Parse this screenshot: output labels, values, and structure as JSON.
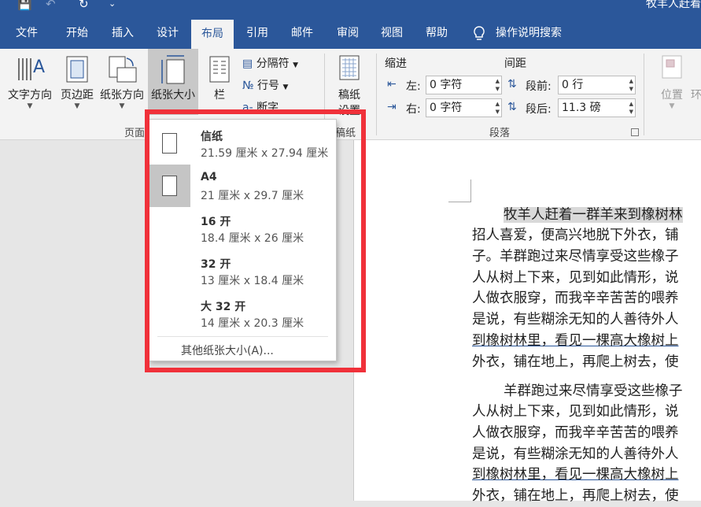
{
  "title_bar": {
    "doc_title": "牧羊人赶着"
  },
  "tabs": [
    {
      "label": "文件"
    },
    {
      "label": "开始"
    },
    {
      "label": "插入"
    },
    {
      "label": "设计"
    },
    {
      "label": "布局"
    },
    {
      "label": "引用"
    },
    {
      "label": "邮件"
    },
    {
      "label": "审阅"
    },
    {
      "label": "视图"
    },
    {
      "label": "帮助"
    },
    {
      "label": "操作说明搜索"
    }
  ],
  "active_tab": "布局",
  "ribbon": {
    "text_direction": "文字方向",
    "margins": "页边距",
    "orientation": "纸张方向",
    "size": "纸张大小",
    "columns": "栏",
    "breaks": "分隔符",
    "line_numbers": "行号",
    "hyphenation": "断字",
    "manuscript_line1": "稿纸",
    "manuscript_line2": "设置",
    "page_setup_group": "页面",
    "manuscript_group": "稿纸",
    "indent_label": "缩进",
    "spacing_label": "间距",
    "indent_left_label": "左:",
    "indent_left_value": "0 字符",
    "indent_right_label": "右:",
    "indent_right_value": "0 字符",
    "spacing_before_label": "段前:",
    "spacing_before_value": "0 行",
    "spacing_after_label": "段后:",
    "spacing_after_value": "11.3 磅",
    "paragraph_group": "段落",
    "position": "位置",
    "wrap_partial": "环"
  },
  "paper_menu": {
    "items": [
      {
        "name": "信纸",
        "dims": "21.59 厘米 x 27.94 厘米",
        "selected": false
      },
      {
        "name": "A4",
        "dims": "21 厘米 x 29.7 厘米",
        "selected": true
      },
      {
        "name": "16 开",
        "dims": "18.4 厘米 x 26 厘米",
        "selected": false
      },
      {
        "name": "32 开",
        "dims": "13 厘米 x 18.4 厘米",
        "selected": false
      },
      {
        "name": "大 32 开",
        "dims": "14 厘米 x 20.3 厘米",
        "selected": false
      }
    ],
    "more": "其他纸张大小(A)..."
  },
  "document": {
    "para1_first": "牧羊人赶着一群羊来到橡树林",
    "para1": [
      "招人喜爱，便高兴地脱下外衣，铺",
      "子。羊群跑过来尽情享受这些橡子",
      "人从树上下来，见到如此情形，说",
      "人做衣服穿，而我辛辛苦苦的喂养",
      "是说，有些糊涂无知的人善待外人",
      "到橡树林里，看见一棵高大橡树上",
      "外衣，铺在地上，再爬上树去，使"
    ],
    "para2_first": "羊群跑过来尽情享受这些橡子",
    "para2": [
      "人从树上下来，见到如此情形，说",
      "人做衣服穿，而我辛辛苦苦的喂养",
      "是说，有些糊涂无知的人善待外人",
      "到橡树林里，看见一棵高大橡树上",
      "外衣，铺在地上，再爬上树去，使"
    ]
  },
  "colors": {
    "ribbon_blue": "#2b579a",
    "highlight_box": "#f0313a",
    "selected_item": "#c5c5c5"
  }
}
